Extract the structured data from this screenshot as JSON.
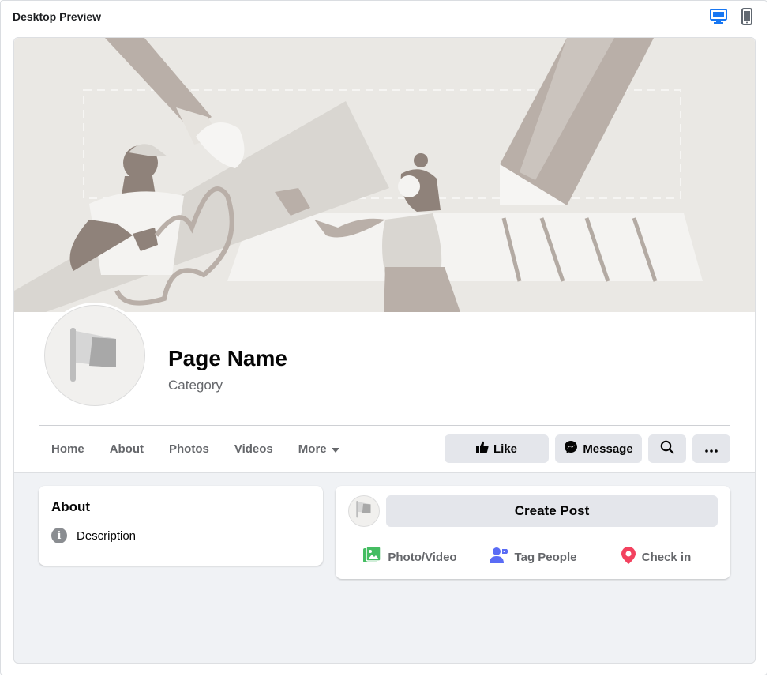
{
  "preview": {
    "title": "Desktop Preview",
    "desktop_icon": "desktop-icon",
    "mobile_icon": "mobile-icon",
    "active_color": "#1877f2",
    "inactive_color": "#606770"
  },
  "page": {
    "name": "Page Name",
    "category": "Category",
    "cover_image": "cover-illustration",
    "profile_icon": "flag-icon"
  },
  "nav": {
    "items": [
      "Home",
      "About",
      "Photos",
      "Videos",
      "More"
    ],
    "more_icon": "caret-down-icon"
  },
  "actions": {
    "like_label": "Like",
    "like_icon": "thumbs-up-icon",
    "message_label": "Message",
    "message_icon": "messenger-icon",
    "search_icon": "search-icon",
    "more_icon": "ellipsis-icon"
  },
  "about": {
    "title": "About",
    "description": "Description",
    "info_icon": "info-icon"
  },
  "composer": {
    "create_post": "Create Post",
    "actions": [
      {
        "label": "Photo/Video",
        "icon": "photo-icon",
        "color": "#45bd62"
      },
      {
        "label": "Tag People",
        "icon": "tag-people-icon",
        "color": "#1877f2"
      },
      {
        "label": "Check in",
        "icon": "location-pin-icon",
        "color": "#f3425f"
      }
    ]
  }
}
